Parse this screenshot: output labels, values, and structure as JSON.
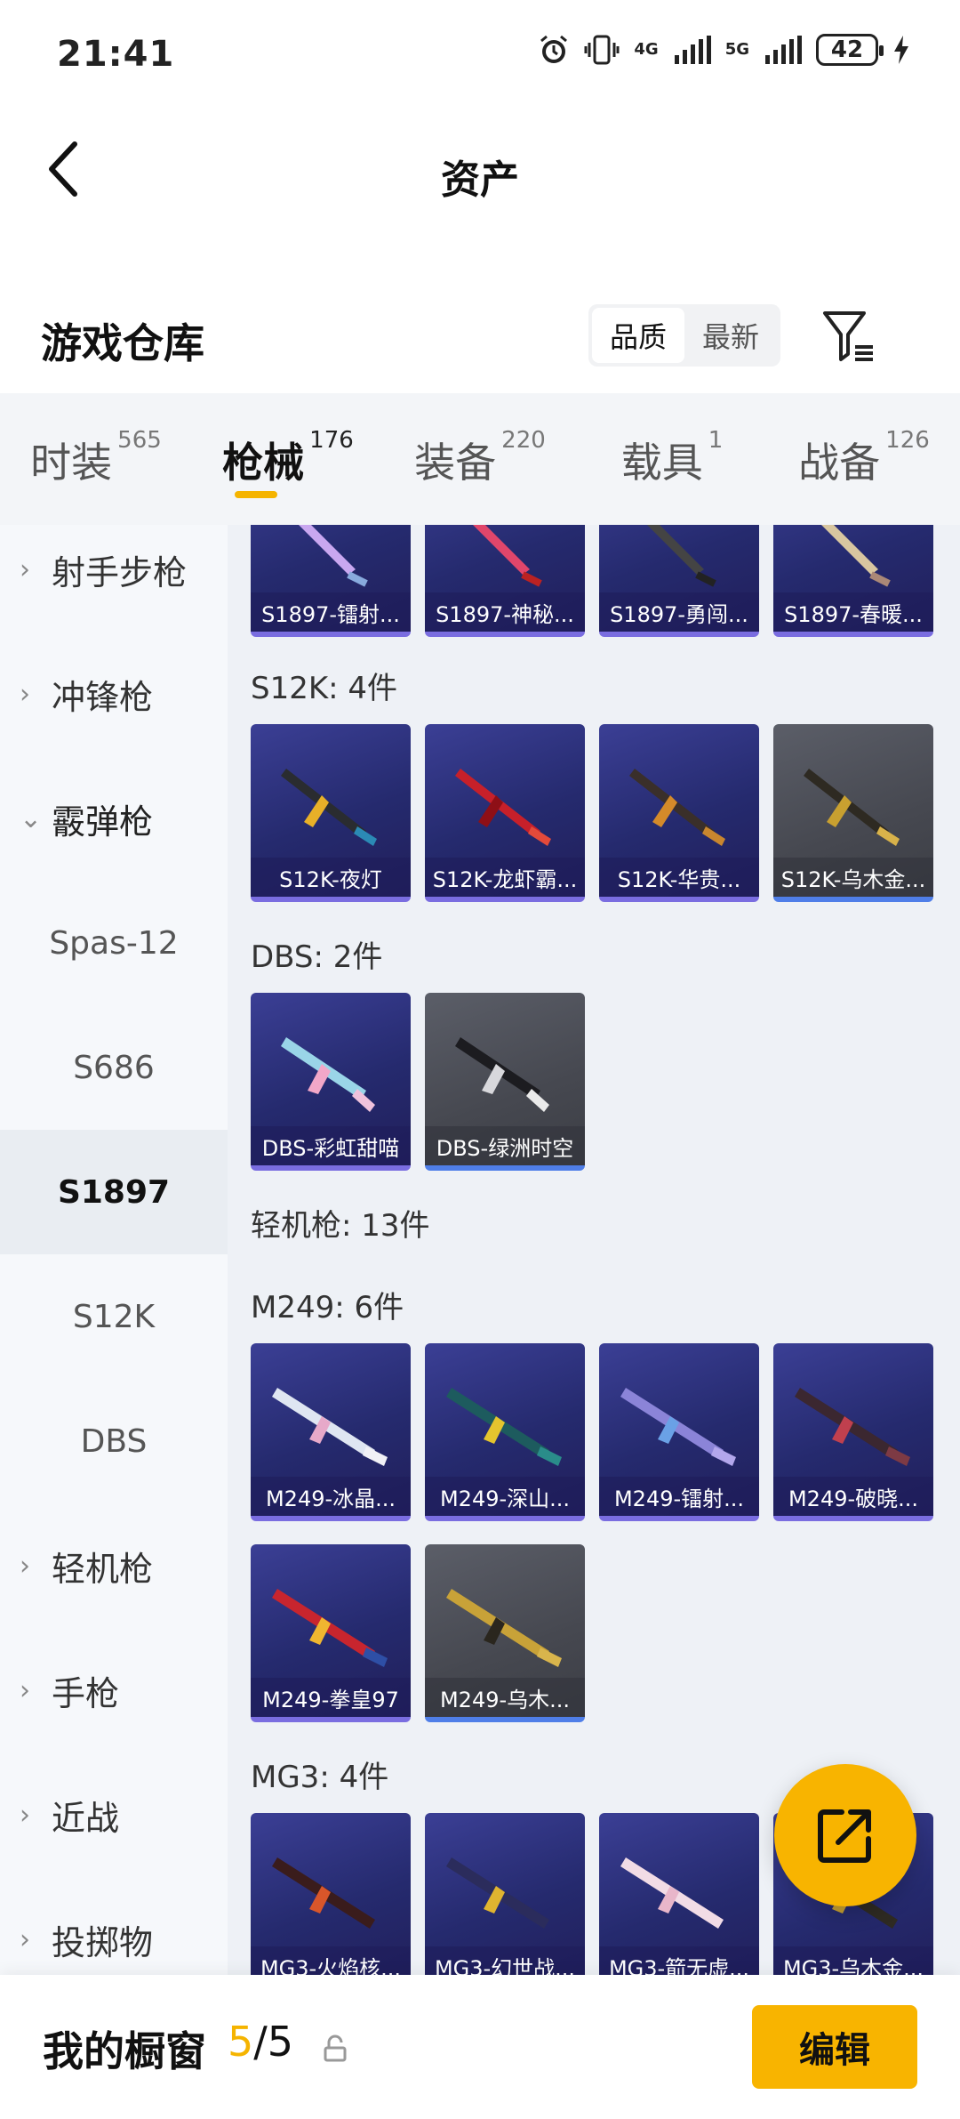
{
  "status_bar": {
    "time": "21:41",
    "network1": "4G",
    "network2": "5G",
    "battery": "42"
  },
  "header": {
    "title": "资产"
  },
  "section": {
    "title": "游戏仓库",
    "sort_quality": "品质",
    "sort_latest": "最新"
  },
  "tabs": [
    {
      "label": "时装",
      "count": "565"
    },
    {
      "label": "枪械",
      "count": "176"
    },
    {
      "label": "装备",
      "count": "220"
    },
    {
      "label": "载具",
      "count": "1"
    },
    {
      "label": "战备",
      "count": "126"
    }
  ],
  "left_nav": [
    {
      "label": "射手步枪",
      "type": "cat"
    },
    {
      "label": "冲锋枪",
      "type": "cat"
    },
    {
      "label": "霰弹枪",
      "type": "cat-open"
    },
    {
      "label": "Spas-12",
      "type": "sub"
    },
    {
      "label": "S686",
      "type": "sub"
    },
    {
      "label": "S1897",
      "type": "sub-sel"
    },
    {
      "label": "S12K",
      "type": "sub"
    },
    {
      "label": "DBS",
      "type": "sub"
    },
    {
      "label": "轻机枪",
      "type": "cat"
    },
    {
      "label": "手枪",
      "type": "cat"
    },
    {
      "label": "近战",
      "type": "cat"
    },
    {
      "label": "投掷物",
      "type": "cat"
    }
  ],
  "groups": {
    "s1897_items": [
      "S1897-镭射...",
      "S1897-神秘...",
      "S1897-勇闯...",
      "S1897-春暖..."
    ],
    "s12k": {
      "label": "S12K: 4件",
      "items": [
        "S12K-夜灯",
        "S12K-龙虾霸...",
        "S12K-华贵...",
        "S12K-乌木金..."
      ]
    },
    "dbs": {
      "label": "DBS: 2件",
      "items": [
        "DBS-彩虹甜喵",
        "DBS-绿洲时空"
      ]
    },
    "lmg": {
      "label": "轻机枪: 13件"
    },
    "m249": {
      "label": "M249: 6件",
      "items": [
        "M249-冰晶...",
        "M249-深山...",
        "M249-镭射...",
        "M249-破晓...",
        "M249-拳皇97",
        "M249-乌木..."
      ]
    },
    "mg3": {
      "label": "MG3: 4件",
      "items": [
        "MG3-火焰核...",
        "MG3-幻世战...",
        "MG3-箭无虚...",
        "MG3-乌木金..."
      ]
    }
  },
  "bottom_bar": {
    "label": "我的橱窗",
    "count_current": "5",
    "count_sep": "/",
    "count_total": "5",
    "edit": "编辑"
  },
  "colors": {
    "accent": "#F8B400",
    "card_purple": "#2B2F7A",
    "card_gray": "#4A4C55"
  }
}
